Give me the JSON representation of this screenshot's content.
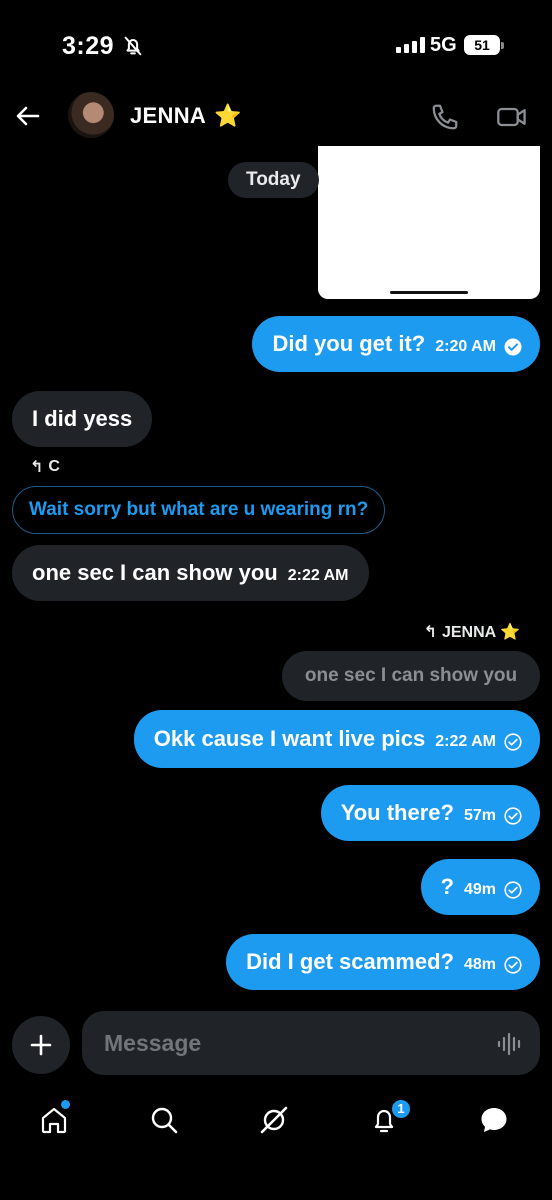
{
  "status_bar": {
    "time": "3:29",
    "network": "5G",
    "battery": "51"
  },
  "header": {
    "contact_name": "JENNA",
    "contact_emoji": "⭐"
  },
  "date_chip": "Today",
  "messages": [
    {
      "direction": "out",
      "text": "Did you get it?",
      "time": "2:20 AM",
      "status": "read"
    },
    {
      "direction": "in",
      "text": "I did yess"
    },
    {
      "direction": "in",
      "reply_to_author": "C",
      "quoted_text": "Wait sorry but what are u wearing rn?",
      "text": "one sec I can show you",
      "time": "2:22 AM"
    },
    {
      "direction": "out",
      "reply_to_author": "JENNA ⭐",
      "quoted_text": "one sec I can show you",
      "text": "Okk cause I want live pics",
      "time": "2:22 AM",
      "status": "sent"
    },
    {
      "direction": "out",
      "text": "You there?",
      "time": "57m",
      "status": "sent"
    },
    {
      "direction": "out",
      "text": "?",
      "time": "49m",
      "status": "sent"
    },
    {
      "direction": "out",
      "text": "Did I get scammed?",
      "time": "48m",
      "status": "sent"
    }
  ],
  "composer": {
    "placeholder": "Message"
  },
  "nav": {
    "notifications_badge": "1"
  },
  "colors": {
    "accent": "#1d9bf0",
    "bubble_in": "#202327",
    "background": "#000000"
  }
}
